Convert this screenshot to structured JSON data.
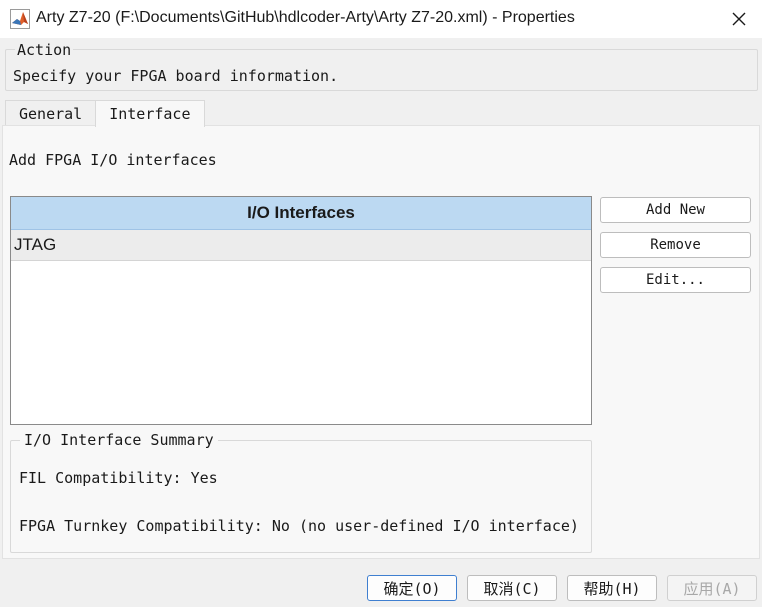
{
  "window": {
    "title": "Arty Z7-20 (F:\\Documents\\GitHub\\hdlcoder-Arty\\Arty Z7-20.xml) - Properties",
    "icon": "matlab-logo-icon",
    "close_icon": "close-icon"
  },
  "action": {
    "legend": "Action",
    "description": "Specify your FPGA board information."
  },
  "tabs": [
    {
      "label": "General",
      "active": false
    },
    {
      "label": "Interface",
      "active": true
    }
  ],
  "interface_panel": {
    "description": "Add FPGA I/O interfaces",
    "table": {
      "header": "I/O Interfaces",
      "rows": [
        "JTAG"
      ]
    },
    "buttons": {
      "add_new": "Add New",
      "remove": "Remove",
      "edit": "Edit..."
    },
    "summary": {
      "legend": "I/O Interface Summary",
      "fil": "FIL Compatibility: Yes",
      "turnkey": "FPGA Turnkey Compatibility: No (no user-defined I/O interface)"
    }
  },
  "footer": {
    "ok": "确定(O)",
    "cancel": "取消(C)",
    "help": "帮助(H)",
    "apply": "应用(A)"
  },
  "colors": {
    "table_header": "#bcd9f2",
    "selected_row": "#ececec",
    "default_button_border": "#3f7fd0"
  }
}
